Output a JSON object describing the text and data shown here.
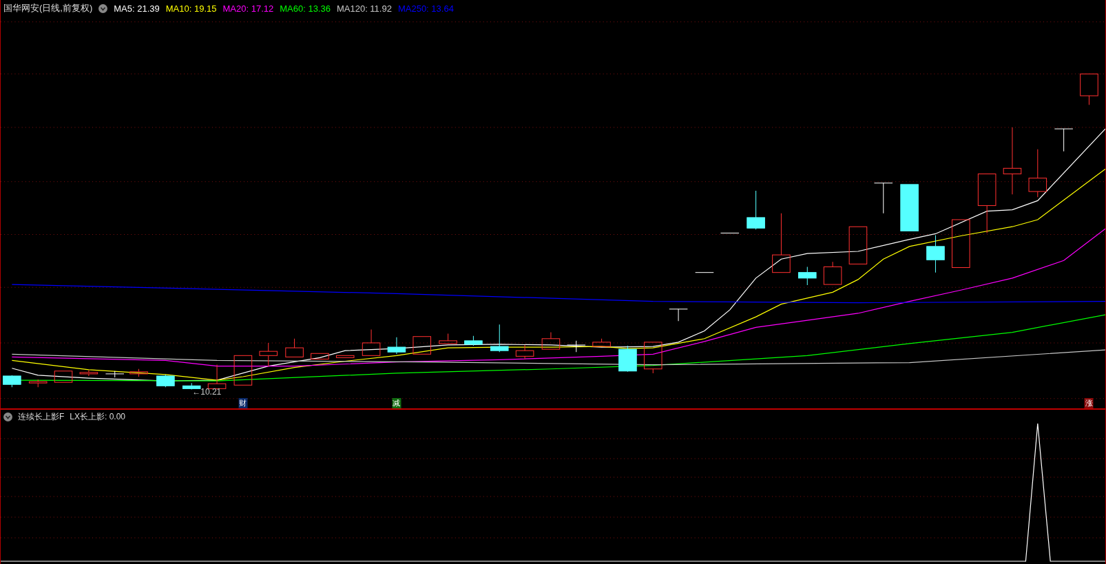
{
  "main_panel": {
    "title": "国华网安(日线,前复权)",
    "ma_legend": [
      {
        "label": "MA5: 21.39",
        "color": "#ffffff"
      },
      {
        "label": "MA10: 19.15",
        "color": "#ffff00"
      },
      {
        "label": "MA20: 17.12",
        "color": "#ff00ff"
      },
      {
        "label": "MA60: 13.36",
        "color": "#00ff00"
      },
      {
        "label": "MA120: 11.92",
        "color": "#c8c8c8"
      },
      {
        "label": "MA250: 13.64",
        "color": "#0000ff"
      }
    ],
    "low_price_label": "←10.21",
    "event_markers": [
      {
        "label": "财",
        "color": "#0a2a6a"
      },
      {
        "label": "减",
        "color": "#106a10"
      },
      {
        "label": "涨",
        "color": "#8a0a0a"
      }
    ]
  },
  "indicator_panel": {
    "name": "连续长上影F",
    "reading": "LX长上影: 0.00"
  }
}
